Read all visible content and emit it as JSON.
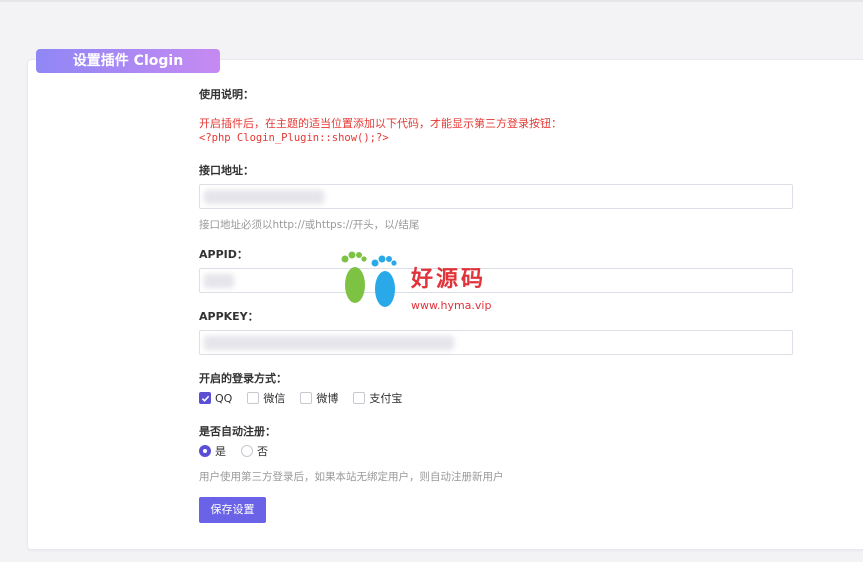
{
  "panel": {
    "title": "设置插件 Clogin"
  },
  "usage": {
    "label": "使用说明：",
    "text": "开启插件后，在主题的适当位置添加以下代码，才能显示第三方登录按钮：",
    "code": "<?php Clogin_Plugin::show();?>"
  },
  "api_url": {
    "label": "接口地址：",
    "value": "",
    "hint": "接口地址必须以http://或https://开头，以/结尾"
  },
  "appid": {
    "label": "APPID：",
    "value": ""
  },
  "appkey": {
    "label": "APPKEY：",
    "value": ""
  },
  "login_methods": {
    "label": "开启的登录方式：",
    "options": [
      {
        "label": "QQ",
        "checked": true
      },
      {
        "label": "微信",
        "checked": false
      },
      {
        "label": "微博",
        "checked": false
      },
      {
        "label": "支付宝",
        "checked": false
      }
    ]
  },
  "auto_register": {
    "label": "是否自动注册：",
    "options": [
      {
        "label": "是",
        "selected": true
      },
      {
        "label": "否",
        "selected": false
      }
    ],
    "hint": "用户使用第三方登录后，如果本站无绑定用户，则自动注册新用户"
  },
  "save_button": "保存设置",
  "watermark": {
    "text": "好源码",
    "url": "www.hyma.vip"
  },
  "colors": {
    "accent": "#6a63e8",
    "title_gradient_start": "#8f87f5",
    "title_gradient_end": "#c68af2",
    "code_red": "#e53935"
  }
}
